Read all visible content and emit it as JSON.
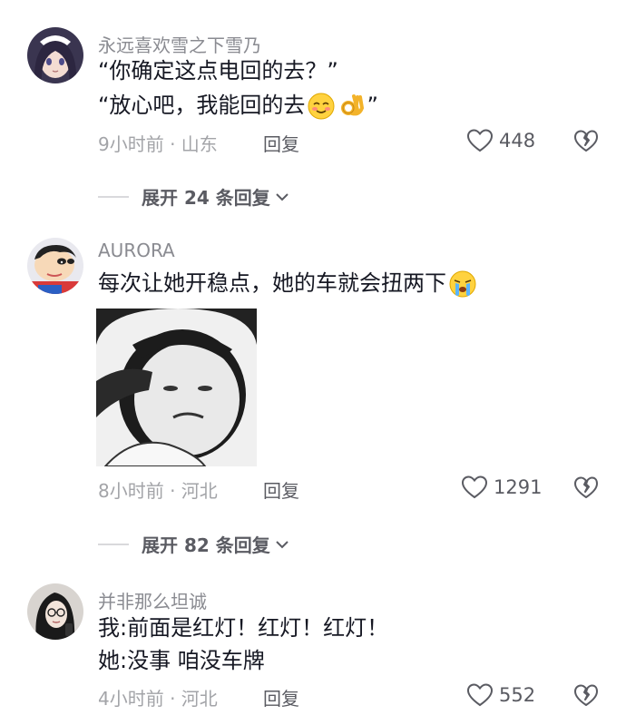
{
  "comments": [
    {
      "username": "永远喜欢雪之下雪乃",
      "lines": [
        "“你确定这点电回的去？”",
        "“放心吧，我能回的去"
      ],
      "closing_quote": "”",
      "emojis": [
        "blush-face-emoji",
        "ok-hand-emoji"
      ],
      "time_location": "9小时前 · 山东",
      "reply_label": "回复",
      "likes": "448",
      "expand_label": "展开 24 条回复"
    },
    {
      "username": "AURORA",
      "lines": [
        "每次让她开稳点，她的车就会扭两下"
      ],
      "emojis": [
        "crying-face-emoji"
      ],
      "time_location": "8小时前 · 河北",
      "reply_label": "回复",
      "likes": "1291",
      "expand_label": "展开 82 条回复"
    },
    {
      "username": "并非那么坦诚",
      "lines": [
        "我:前面是红灯！红灯！红灯！",
        "她:没事 咱没车牌"
      ],
      "time_location": "4小时前 · 河北",
      "reply_label": "回复",
      "likes": "552"
    }
  ],
  "colors": {
    "text": "#161823",
    "username": "#8a8b91",
    "meta": "#a3a4a8",
    "action": "#5a5b62"
  },
  "icons": [
    "heart-outline-icon",
    "broken-heart-icon",
    "chevron-down-icon"
  ]
}
